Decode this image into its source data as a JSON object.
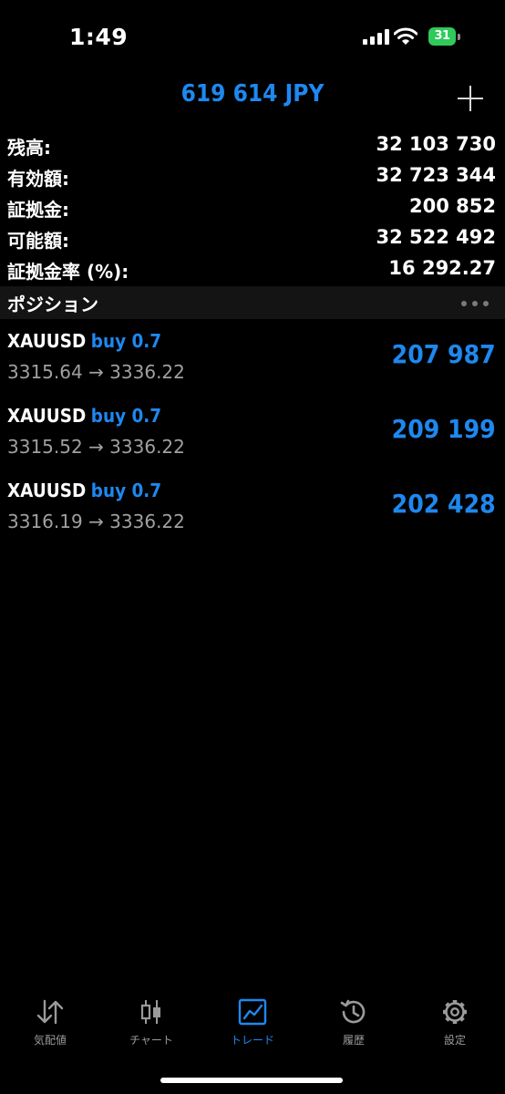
{
  "status_bar": {
    "time": "1:49",
    "battery": "31",
    "battery_color": "#2fca5a"
  },
  "header": {
    "title": "619 614 JPY",
    "add_icon": "plus-icon"
  },
  "summary": [
    {
      "label": "残高:",
      "value": "32 103 730"
    },
    {
      "label": "有効額:",
      "value": "32 723 344"
    },
    {
      "label": "証拠金:",
      "value": "200 852"
    },
    {
      "label": "可能額:",
      "value": "32 522 492"
    },
    {
      "label": "証拠金率 (%):",
      "value": "16 292.27"
    }
  ],
  "positions_section": {
    "title": "ポジション",
    "more_icon": "more-icon"
  },
  "positions": [
    {
      "symbol": "XAUUSD",
      "type": "buy 0.7",
      "prices": "3315.64 → 3336.22",
      "profit": "207 987"
    },
    {
      "symbol": "XAUUSD",
      "type": "buy 0.7",
      "prices": "3315.52 → 3336.22",
      "profit": "209 199"
    },
    {
      "symbol": "XAUUSD",
      "type": "buy 0.7",
      "prices": "3316.19 → 3336.22",
      "profit": "202 428"
    }
  ],
  "tabs": [
    {
      "label": "気配値",
      "icon": "quotes-arrows-icon",
      "active": false
    },
    {
      "label": "チャート",
      "icon": "candlestick-icon",
      "active": false
    },
    {
      "label": "トレード",
      "icon": "trade-chart-icon",
      "active": true
    },
    {
      "label": "履歴",
      "icon": "history-icon",
      "active": false
    },
    {
      "label": "設定",
      "icon": "gear-icon",
      "active": false
    }
  ],
  "colors": {
    "accent": "#1e88f0",
    "background": "#000000",
    "section_background": "#141414",
    "secondary_text": "#a0a0a0"
  }
}
